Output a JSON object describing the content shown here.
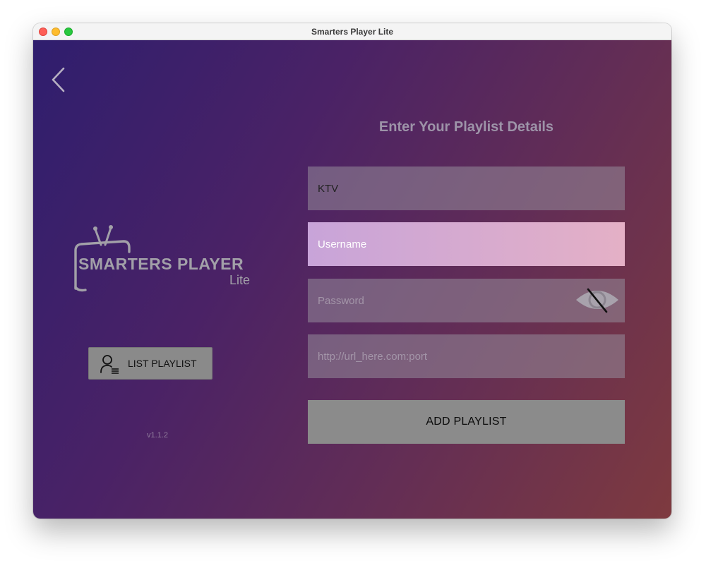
{
  "window": {
    "title": "Smarters Player Lite"
  },
  "nav": {
    "back_icon": "chevron-left-icon"
  },
  "logo": {
    "main": "SMARTERS PLAYER",
    "sub": "Lite",
    "icon": "tv-icon"
  },
  "list_playlist": {
    "label": "LIST PLAYLIST",
    "icon": "user-list-icon"
  },
  "version": "v1.1.2",
  "form": {
    "title": "Enter Your Playlist Details",
    "playlist_name": {
      "value": "KTV",
      "placeholder": ""
    },
    "username": {
      "value": "",
      "placeholder": "Username"
    },
    "password": {
      "value": "",
      "placeholder": "Password",
      "toggle_icon": "eye-slash-icon"
    },
    "url": {
      "value": "",
      "placeholder": "http://url_here.com:port"
    },
    "submit_label": "ADD PLAYLIST"
  },
  "colors": {
    "gradient_start": "#2f1e6e",
    "gradient_end": "#7e3a3f",
    "active_field": "#d7aacf",
    "button_gray": "#8b8b8b"
  }
}
